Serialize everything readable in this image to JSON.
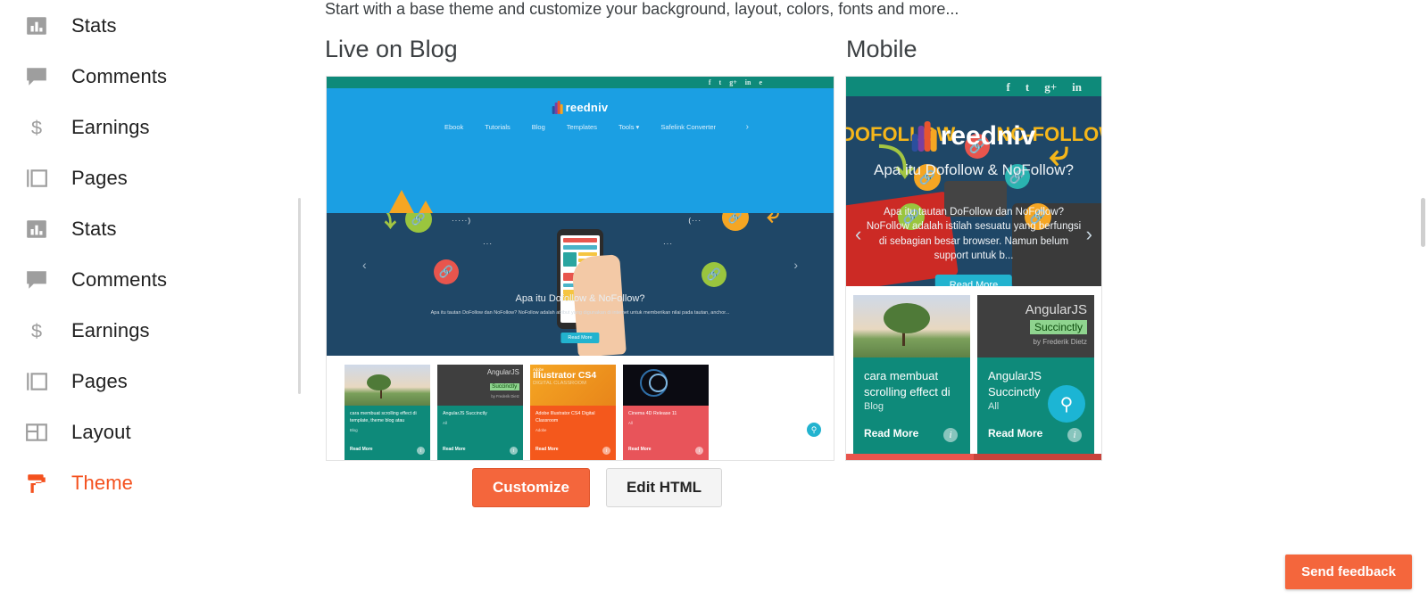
{
  "sidebar": {
    "items": [
      {
        "label": "Stats",
        "icon": "bar-chart-icon",
        "active": false
      },
      {
        "label": "Comments",
        "icon": "comment-bubble-icon",
        "active": false
      },
      {
        "label": "Earnings",
        "icon": "dollar-sign-icon",
        "active": false
      },
      {
        "label": "Pages",
        "icon": "pages-icon",
        "active": false
      },
      {
        "label": "Stats",
        "icon": "bar-chart-icon",
        "active": false
      },
      {
        "label": "Comments",
        "icon": "comment-bubble-icon",
        "active": false
      },
      {
        "label": "Earnings",
        "icon": "dollar-sign-icon",
        "active": false
      },
      {
        "label": "Pages",
        "icon": "pages-icon",
        "active": false
      },
      {
        "label": "Layout",
        "icon": "layout-icon",
        "active": false
      },
      {
        "label": "Theme",
        "icon": "paint-roller-icon",
        "active": true
      }
    ]
  },
  "main": {
    "subtitle": "Start with a base theme and customize your background, layout, colors, fonts and more...",
    "live_title": "Live on Blog",
    "mobile_title": "Mobile"
  },
  "buttons": {
    "customize": "Customize",
    "edit_html": "Edit HTML",
    "send_feedback": "Send feedback"
  },
  "blog_preview": {
    "logo": "reedniv",
    "social": [
      "f",
      "t",
      "g+",
      "in",
      "e"
    ],
    "nav": [
      "Ebook",
      "Tutorials",
      "Blog",
      "Templates",
      "Tools ▾",
      "Safelink Converter"
    ],
    "nav_arrow": "›",
    "hero": {
      "title": "Apa itu Dofollow & NoFollow?",
      "description": "Apa itu tautan DoFollow dan NoFollow? NoFollow adalah atribut yang digunakan di internet untuk memberikan nilai pada tautan, anchor...",
      "button": "Read More",
      "prev": "‹",
      "next": "›"
    },
    "cards": [
      {
        "title": "cara membuat scrolling effect di template, theme blog atau",
        "category": "Blog",
        "read_more": "Read More",
        "color": "#0e8a7a",
        "strip": "#555555",
        "thumb": "photo-tree"
      },
      {
        "title": "AngularJS Succinctly",
        "category": "All",
        "read_more": "Read More",
        "color": "#0e8a7a",
        "strip": "#3fa9f5",
        "thumb": "angularjs-book",
        "cover_title": "AngularJS",
        "cover_badge": "Succinctly",
        "cover_author": "by Frederik Dietz"
      },
      {
        "title": "Adobe Illustrator CS4 Digital Classroom",
        "category": "Adobe",
        "read_more": "Read More",
        "color": "#f4581c",
        "strip": "#9b2fae",
        "thumb": "illustrator-cover",
        "cover_brand": "Adobe",
        "cover_title": "Illustrator CS4",
        "cover_sub": "DIGITAL CLASSROOM"
      },
      {
        "title": "Cinema 4D Release 11",
        "category": "All",
        "read_more": "Read More",
        "color": "#e8545a",
        "strip": "#f5a623",
        "thumb": "cinema4d-cover"
      }
    ]
  },
  "mobile_preview": {
    "logo": "reedniv",
    "social": [
      "f",
      "t",
      "g+",
      "in"
    ],
    "word_left": "DOFOLLOW",
    "word_right": "NO-FOLLOW",
    "hero": {
      "title": "Apa itu Dofollow & NoFollow?",
      "description": "Apa itu tautan DoFollow dan NoFollow? NoFollow adalah istilah sesuatu yang berfungsi di sebagian besar browser. Namun belum support untuk b...",
      "button": "Read More",
      "prev": "‹",
      "next": "›"
    },
    "cards": [
      {
        "title": "cara membuat scrolling effect di",
        "category": "Blog",
        "read_more": "Read More",
        "thumb": "photo-tree"
      },
      {
        "title": "AngularJS Succinctly",
        "category": "All",
        "read_more": "Read More",
        "thumb": "angularjs-book",
        "cover_title": "AngularJS",
        "cover_badge": "Succinctly",
        "cover_author": "by Frederik Dietz"
      }
    ]
  },
  "colors": {
    "accent": "#f4663c",
    "theme_active": "#f4511e",
    "teal": "#0e8a7a",
    "blue": "#1b9fe3",
    "navy": "#1f4767",
    "cyan": "#22b3cf"
  }
}
